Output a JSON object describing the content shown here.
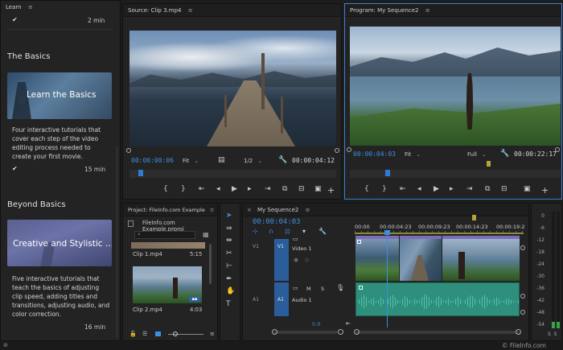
{
  "learn": {
    "title": "Learn",
    "menu": "≡",
    "top_duration": "2 min",
    "sections": [
      {
        "heading": "The Basics",
        "card_title": "Learn the Basics",
        "description": "Four interactive tutorials that cover each step of the video editing process needed to create your first movie.",
        "duration": "15 min"
      },
      {
        "heading": "Beyond Basics",
        "card_title": "Creative and Stylistic ...",
        "description": "Five interactive tutorials that teach the basics of adjusting clip speed, adding titles and transitions, adjusting audio, and color correction.",
        "duration": "16 min"
      }
    ]
  },
  "source": {
    "title": "Source: Clip 3.mp4",
    "menu": "≡",
    "timecode": "00:00:00:06",
    "zoom": "Fit",
    "resolution": "1/2",
    "duration": "00:00:04:12"
  },
  "program": {
    "title": "Program: My Sequence2",
    "menu": "≡",
    "timecode": "00:00:04:03",
    "zoom": "Fit",
    "resolution": "Full",
    "duration": "00:00:22:17"
  },
  "project": {
    "title": "Project: FileInfo.com Example",
    "menu": "≡",
    "file": "FileInfo.com Example.prproj",
    "clips": [
      {
        "name": "Clip 1.mp4",
        "duration": "5:15"
      },
      {
        "name": "Clip 2.mp4",
        "duration": "4:03"
      }
    ]
  },
  "timeline": {
    "title": "My Sequence2",
    "menu": "≡",
    "timecode": "00:00:04:03",
    "ruler": [
      "00:00",
      "00:00:04:23",
      "00:00:09:23",
      "00:00:14:23",
      "00:00:19:2"
    ],
    "video_track": {
      "id": "V1",
      "name": "Video 1"
    },
    "audio_track": {
      "id": "A1",
      "name": "Audio 1"
    },
    "audio_volume": "0.0",
    "audio_mute": "M",
    "audio_solo": "S"
  },
  "meter": {
    "levels": [
      "0",
      "-6",
      "-12",
      "-18",
      "-24",
      "-30",
      "-36",
      "-42",
      "-48",
      "-54"
    ],
    "footer": "S  S"
  },
  "watermark": "© FileInfo.com",
  "colors": {
    "accent": "#3d8ee0",
    "audio": "#2f8f7d",
    "video_clip": "#6f63a9"
  }
}
